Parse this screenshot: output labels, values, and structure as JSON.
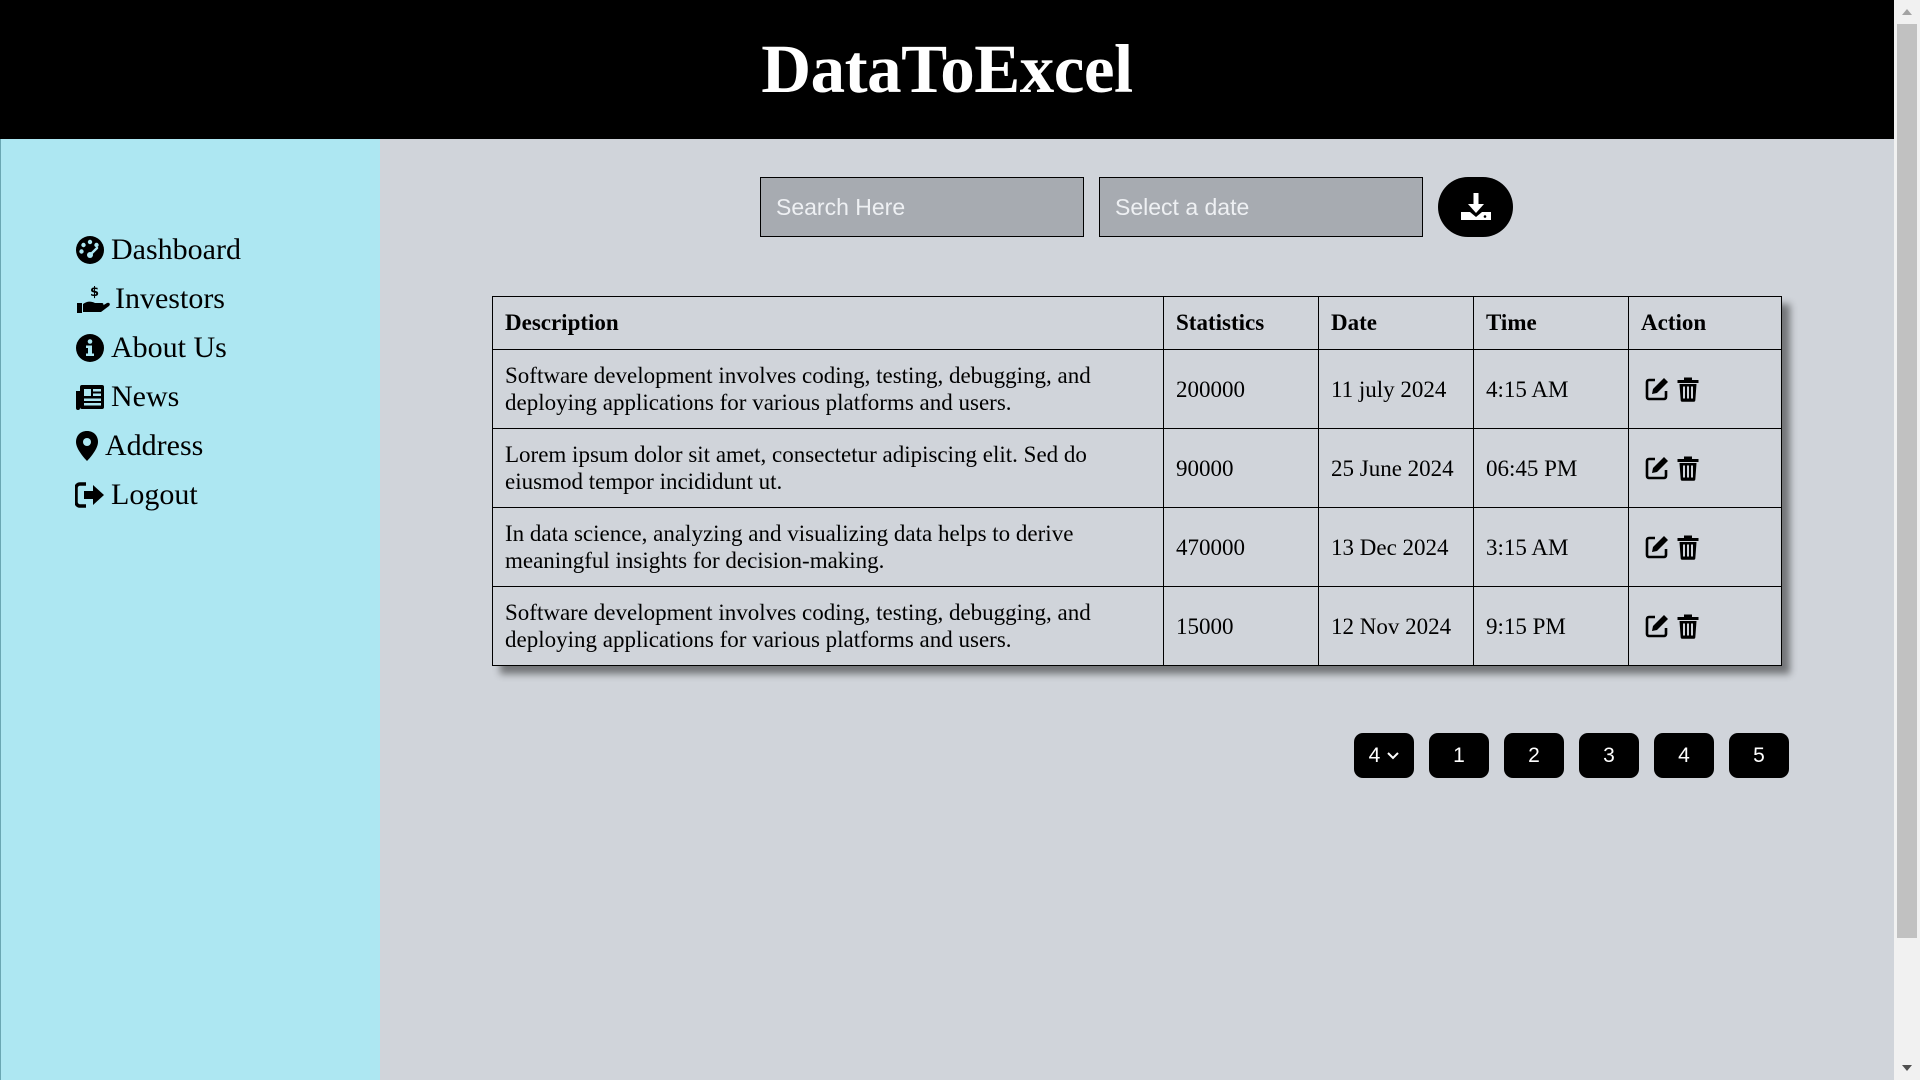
{
  "header": {
    "title": "DataToExcel"
  },
  "sidebar": {
    "items": [
      {
        "label": "Dashboard",
        "icon": "dashboard-icon"
      },
      {
        "label": "Investors",
        "icon": "hand-dollar-icon"
      },
      {
        "label": "About Us",
        "icon": "info-icon"
      },
      {
        "label": "News",
        "icon": "newspaper-icon"
      },
      {
        "label": "Address",
        "icon": "map-pin-icon"
      },
      {
        "label": "Logout",
        "icon": "logout-icon"
      }
    ]
  },
  "toolbar": {
    "search_placeholder": "Search Here",
    "date_placeholder": "Select a date",
    "download_icon": "download-icon"
  },
  "table": {
    "headers": [
      "Description",
      "Statistics",
      "Date",
      "Time",
      "Action"
    ],
    "rows": [
      {
        "description": "Software development involves coding, testing, debugging, and deploying applications for various platforms and users.",
        "statistics": "200000",
        "date": "11 july 2024",
        "time": "4:15 AM"
      },
      {
        "description": "Lorem ipsum dolor sit amet, consectetur adipiscing elit. Sed do eiusmod tempor incididunt ut.",
        "statistics": "90000",
        "date": "25 June 2024",
        "time": "06:45 PM"
      },
      {
        "description": "In data science, analyzing and visualizing data helps to derive meaningful insights for decision-making.",
        "statistics": "470000",
        "date": "13 Dec 2024",
        "time": "3:15 AM"
      },
      {
        "description": "Software development involves coding, testing, debugging, and deploying applications for various platforms and users.",
        "statistics": "15000",
        "date": "12 Nov 2024",
        "time": "9:15 PM"
      }
    ],
    "action_icons": [
      "edit-icon",
      "trash-icon"
    ]
  },
  "pagination": {
    "per_page_selected": "4",
    "pages": [
      "1",
      "2",
      "3",
      "4",
      "5"
    ]
  },
  "colors": {
    "header_bg": "#000000",
    "sidebar_bg": "#ade7f2",
    "main_bg": "#d0d4da",
    "input_bg": "#a7abb1"
  }
}
